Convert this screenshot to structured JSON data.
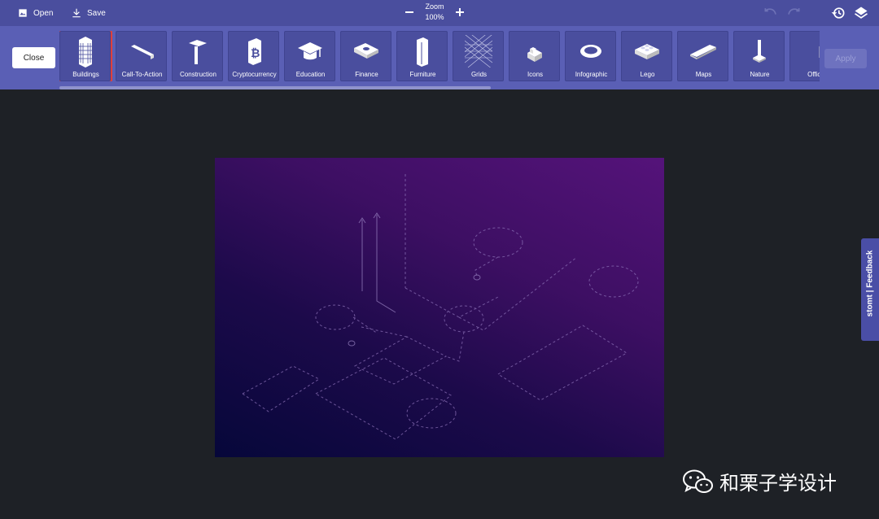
{
  "toolbar": {
    "open_label": "Open",
    "save_label": "Save",
    "zoom_label": "Zoom",
    "zoom_value": "100%"
  },
  "category_bar": {
    "close_label": "Close",
    "apply_label": "Apply",
    "selected": "Buildings",
    "categories": [
      {
        "label": "Buildings",
        "icon": "building-icon"
      },
      {
        "label": "Call-To-Action",
        "icon": "call-to-action-icon"
      },
      {
        "label": "Construction",
        "icon": "hammer-icon"
      },
      {
        "label": "Cryptocurrency",
        "icon": "bitcoin-icon"
      },
      {
        "label": "Education",
        "icon": "graduation-cap-icon"
      },
      {
        "label": "Finance",
        "icon": "money-icon"
      },
      {
        "label": "Furniture",
        "icon": "cabinet-icon"
      },
      {
        "label": "Grids",
        "icon": "grid-icon"
      },
      {
        "label": "Icons",
        "icon": "cube-icon"
      },
      {
        "label": "Infographic",
        "icon": "ring-icon"
      },
      {
        "label": "Lego",
        "icon": "lego-brick-icon"
      },
      {
        "label": "Maps",
        "icon": "map-tile-icon"
      },
      {
        "label": "Nature",
        "icon": "tree-icon"
      },
      {
        "label": "Office",
        "icon": "office-icon"
      }
    ]
  },
  "feedback": {
    "label": "stomt | Feedback"
  },
  "watermark": {
    "text": "和栗子学设计"
  },
  "colors": {
    "topbar": "#4a4e9e",
    "catbar": "#5a5fb5",
    "canvas_bg": "#1e2126",
    "selection": "#e0403a"
  }
}
